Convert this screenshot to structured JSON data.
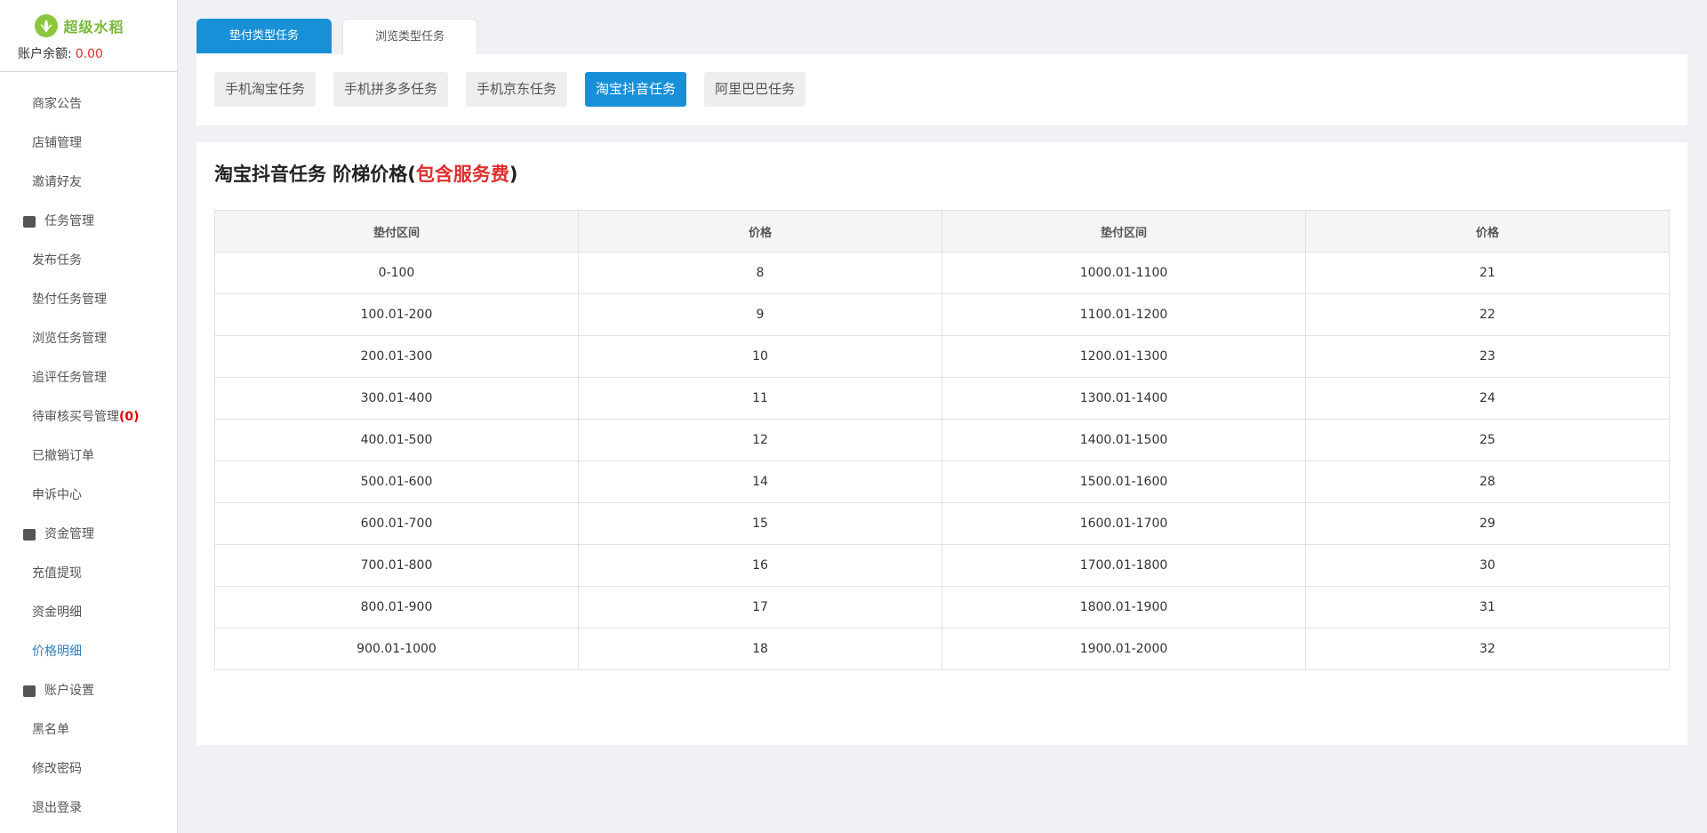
{
  "app": {
    "logo_text": "超级水稻",
    "balance_label": "账户余额:",
    "balance_value": "0.00"
  },
  "sidebar": {
    "items": [
      {
        "label": "商家公告",
        "type": "item"
      },
      {
        "label": "店铺管理",
        "type": "item"
      },
      {
        "label": "邀请好友",
        "type": "item"
      },
      {
        "label": "任务管理",
        "type": "group",
        "icon": "task-list-icon"
      },
      {
        "label": "发布任务",
        "type": "item"
      },
      {
        "label": "垫付任务管理",
        "type": "item"
      },
      {
        "label": "浏览任务管理",
        "type": "item"
      },
      {
        "label": "追评任务管理",
        "type": "item"
      },
      {
        "label": "待审核买号管理",
        "type": "item",
        "badge": "(0)"
      },
      {
        "label": "已撤销订单",
        "type": "item"
      },
      {
        "label": "申诉中心",
        "type": "item"
      },
      {
        "label": "资金管理",
        "type": "group",
        "icon": "wallet-icon"
      },
      {
        "label": "充值提现",
        "type": "item"
      },
      {
        "label": "资金明细",
        "type": "item"
      },
      {
        "label": "价格明细",
        "type": "item",
        "active": true
      },
      {
        "label": "账户设置",
        "type": "group",
        "icon": "store-icon"
      },
      {
        "label": "黑名单",
        "type": "item"
      },
      {
        "label": "修改密码",
        "type": "item"
      },
      {
        "label": "退出登录",
        "type": "item"
      }
    ]
  },
  "top_tabs": [
    {
      "label": "垫付类型任务",
      "active": true
    },
    {
      "label": "浏览类型任务",
      "active": false
    }
  ],
  "categories": [
    {
      "label": "手机淘宝任务",
      "active": false
    },
    {
      "label": "手机拼多多任务",
      "active": false
    },
    {
      "label": "手机京东任务",
      "active": false
    },
    {
      "label": "淘宝抖音任务",
      "active": true
    },
    {
      "label": "阿里巴巴任务",
      "active": false
    }
  ],
  "heading": {
    "main": "淘宝抖音任务 阶梯价格(",
    "highlight": "包含服务费",
    "close": ")"
  },
  "table": {
    "headers": [
      "垫付区间",
      "价格",
      "垫付区间",
      "价格"
    ],
    "rows": [
      [
        "0-100",
        "8",
        "1000.01-1100",
        "21"
      ],
      [
        "100.01-200",
        "9",
        "1100.01-1200",
        "22"
      ],
      [
        "200.01-300",
        "10",
        "1200.01-1300",
        "23"
      ],
      [
        "300.01-400",
        "11",
        "1300.01-1400",
        "24"
      ],
      [
        "400.01-500",
        "12",
        "1400.01-1500",
        "25"
      ],
      [
        "500.01-600",
        "14",
        "1500.01-1600",
        "28"
      ],
      [
        "600.01-700",
        "15",
        "1600.01-1700",
        "29"
      ],
      [
        "700.01-800",
        "16",
        "1700.01-1800",
        "30"
      ],
      [
        "800.01-900",
        "17",
        "1800.01-1900",
        "31"
      ],
      [
        "900.01-1000",
        "18",
        "1900.01-2000",
        "32"
      ]
    ]
  },
  "colors": {
    "accent": "#1890d8",
    "highlight": "#e02e2e",
    "active_link": "#2e7fc0"
  }
}
